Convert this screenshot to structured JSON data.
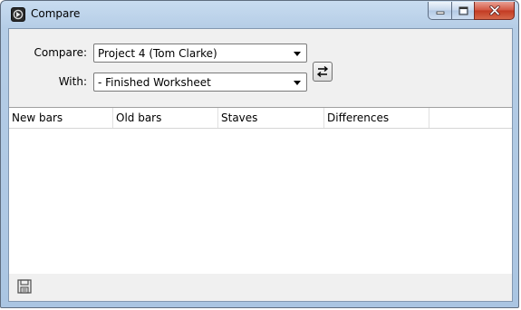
{
  "window": {
    "title": "Compare"
  },
  "form": {
    "compare_label": "Compare:",
    "compare_value": "Project 4 (Tom Clarke)",
    "with_label": "With:",
    "with_value": "- Finished Worksheet"
  },
  "table": {
    "columns": [
      "New bars",
      "Old bars",
      "Staves",
      "Differences"
    ],
    "rows": []
  },
  "icons": {
    "app": "app-logo-icon",
    "swap": "swap-arrows-icon",
    "save": "save-disk-icon"
  }
}
